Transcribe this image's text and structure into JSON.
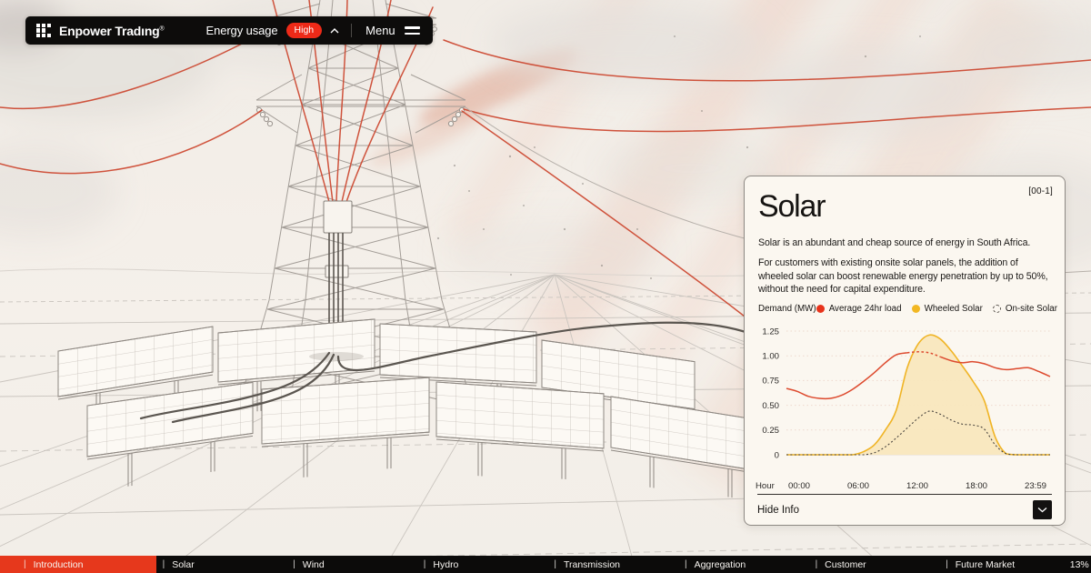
{
  "header": {
    "brand": "Enpower Tradıng",
    "brand_mark": "®",
    "energy_usage_label": "Energy usage",
    "energy_usage_value": "High",
    "menu_label": "Menu"
  },
  "icons": {
    "brand_logo": "grid-logo-icon",
    "energy_usage": "chevron-up-icon",
    "menu": "hamburger-menu-icon",
    "hide_info": "chevron-down-icon",
    "legend_markers": [
      "red-dot",
      "yellow-dot",
      "dashed-circle"
    ]
  },
  "card": {
    "index_label": "[00-1]",
    "title": "Solar",
    "paragraph1": "Solar is an abundant and cheap source of energy in South Africa.",
    "paragraph2": "For customers with existing onsite solar panels, the addition of wheeled solar can boost renewable energy penetration by up to 50%, without the need for capital expenditure.",
    "hide_info_label": "Hide Info"
  },
  "chart_data": {
    "type": "area",
    "title": "Demand (MW)",
    "ylabel": "Demand (MW)",
    "xlabel": "Hour",
    "ylim": [
      0,
      1.25
    ],
    "grid": "horizontal-dotted",
    "legend_position": "top-right",
    "yticks": [
      {
        "v": 0,
        "label": "0"
      },
      {
        "v": 0.25,
        "label": "0.25"
      },
      {
        "v": 0.5,
        "label": "0.50"
      },
      {
        "v": 0.75,
        "label": "0.75"
      },
      {
        "v": 1,
        "label": "1.00"
      },
      {
        "v": 1.25,
        "label": "1.25"
      }
    ],
    "x_ticks": [
      "00:00",
      "06:00",
      "12:00",
      "18:00",
      "23:59"
    ],
    "x_hours": [
      0,
      1,
      2,
      3,
      4,
      5,
      6,
      7,
      8,
      9,
      10,
      11,
      12,
      13,
      14,
      15,
      16,
      17,
      18,
      19,
      20,
      21,
      22,
      23,
      24
    ],
    "legend": [
      {
        "label": "Average 24hr load",
        "marker": "dot",
        "color": "#E8331B"
      },
      {
        "label": "Wheeled Solar",
        "marker": "dot",
        "color": "#F2B722"
      },
      {
        "label": "On-site Solar",
        "marker": "dashed-circle",
        "color": "#55504A"
      }
    ],
    "series": [
      {
        "name": "Average 24hr load",
        "style": "line",
        "color": "#dd4a2e",
        "dash_hours": [
          11,
          14
        ],
        "values": [
          0.67,
          0.64,
          0.59,
          0.57,
          0.57,
          0.6,
          0.66,
          0.74,
          0.83,
          0.93,
          1.01,
          1.03,
          1.04,
          1.03,
          0.99,
          0.95,
          0.93,
          0.94,
          0.92,
          0.88,
          0.86,
          0.87,
          0.88,
          0.84,
          0.79
        ]
      },
      {
        "name": "Wheeled Solar",
        "style": "area",
        "color": "#f0b425",
        "fill": "#f8e6bc",
        "values": [
          0,
          0,
          0,
          0,
          0,
          0,
          0,
          0.03,
          0.1,
          0.25,
          0.45,
          0.88,
          1.12,
          1.21,
          1.17,
          1.05,
          0.9,
          0.74,
          0.55,
          0.18,
          0.01,
          0,
          0,
          0,
          0
        ]
      },
      {
        "name": "On-site Solar",
        "style": "dashed",
        "color": "#4a453f",
        "values": [
          0,
          0,
          0,
          0,
          0,
          0,
          0,
          0,
          0.02,
          0.08,
          0.17,
          0.27,
          0.37,
          0.44,
          0.41,
          0.35,
          0.31,
          0.3,
          0.26,
          0.1,
          0.01,
          0,
          0,
          0,
          0
        ]
      }
    ]
  },
  "footer_nav": {
    "items": [
      {
        "label": "Introduction",
        "active": true
      },
      {
        "label": "Solar",
        "active": false
      },
      {
        "label": "Wind",
        "active": false
      },
      {
        "label": "Hydro",
        "active": false
      },
      {
        "label": "Transmission",
        "active": false
      },
      {
        "label": "Aggregation",
        "active": false
      },
      {
        "label": "Customer",
        "active": false
      },
      {
        "label": "Future Market",
        "active": false
      }
    ],
    "progress": "13%"
  },
  "colors": {
    "accent_red": "#E6381C",
    "badge_red": "#EE2A18",
    "chart_red": "#DD4A2E",
    "chart_yellow": "#F0B425",
    "chart_yellow_fill": "#F8E6BC",
    "card_bg": "#FBF7F0",
    "page_bg": "#F3EFE9",
    "bar_bg": "#0C0B0A"
  }
}
